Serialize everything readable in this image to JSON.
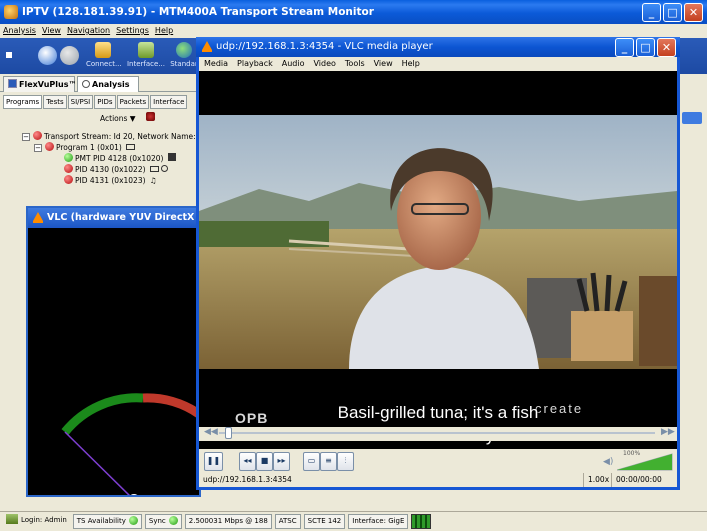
{
  "main_window": {
    "title": "IPTV (128.181.39.91) - MTM400A Transport Stream Monitor",
    "menu": [
      "Analysis",
      "View",
      "Navigation",
      "Settings",
      "Help"
    ],
    "toolbar": {
      "connect_label": "Connect...",
      "interface_label": "Interface...",
      "standard_label": "Standar"
    },
    "tabs": [
      "FlexVuPlus™",
      "Analysis"
    ],
    "subtabs": [
      "Programs",
      "Tests",
      "SI/PSI",
      "PIDs",
      "Packets",
      "Interface"
    ],
    "actions_label": "Actions",
    "tree": {
      "stream": "Transport Stream: Id 20, Network Name:",
      "program": "Program 1 (0x01)",
      "pids": [
        "PMT PID 4128 (0x1020)",
        "PID 4130 (0x1022)",
        "PID 4131 (0x1023)"
      ]
    }
  },
  "hw_vlc": {
    "title": "VLC (hardware YUV DirectX output"
  },
  "vlc": {
    "title": "udp://192.168.1.3:4354 - VLC media player",
    "menu": [
      "Media",
      "Playback",
      "Audio",
      "Video",
      "Tools",
      "View",
      "Help"
    ],
    "subtitle_line1": "Basil-grilled tuna; it's a fish",
    "subtitle_line2": "steak in a hurry.",
    "watermark_left": "OPB",
    "watermark_right": "create",
    "volume_label": "100%",
    "status_url": "udp://192.168.1.3:4354",
    "speed": "1.00x",
    "time": "00:00/00:00",
    "seek_position": 0.02,
    "volume_level": 1.0
  },
  "statusbar": {
    "login": "Login: Admin",
    "ts_availability": "TS Availability",
    "sync": "Sync",
    "rate": "2.500031 Mbps @ 188",
    "atsc": "ATSC",
    "scte": "SCTE 142",
    "interface": "Interface: GigE"
  },
  "colors": {
    "xp_blue": "#0a5fde",
    "status_green": "#1e9a10",
    "status_red": "#b40d0d",
    "vlc_orange": "#ff8c00"
  }
}
